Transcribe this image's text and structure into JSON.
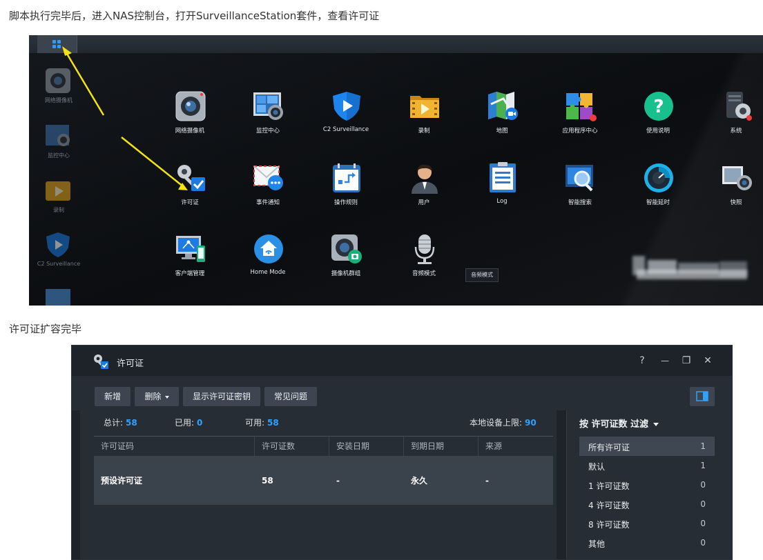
{
  "captions": {
    "step1": "脚本执行完毕后，进入NAS控制台，打开SurveillanceStation套件，查看许可证",
    "step2": "许可证扩容完毕"
  },
  "desktop": {
    "sidebar": [
      "网络摄像机",
      "监控中心",
      "录制",
      "C2 Surveillance"
    ],
    "apps": [
      {
        "label": "网络摄像机",
        "icon": "camera-icon"
      },
      {
        "label": "监控中心",
        "icon": "monitor-center-icon"
      },
      {
        "label": "C2 Surveillance",
        "icon": "c2-shield-icon"
      },
      {
        "label": "录制",
        "icon": "recording-folder-icon"
      },
      {
        "label": "地图",
        "icon": "map-icon"
      },
      {
        "label": "应用程序中心",
        "icon": "puzzle-icon"
      },
      {
        "label": "使用说明",
        "icon": "help-icon"
      },
      {
        "label": "系统",
        "icon": "system-gear-icon"
      },
      {
        "label": "许可证",
        "icon": "license-key-icon"
      },
      {
        "label": "事件通知",
        "icon": "notification-icon"
      },
      {
        "label": "操作规则",
        "icon": "action-rule-icon"
      },
      {
        "label": "用户",
        "icon": "user-icon"
      },
      {
        "label": "Log",
        "icon": "log-icon"
      },
      {
        "label": "智能搜索",
        "icon": "smart-search-icon"
      },
      {
        "label": "智能延时",
        "icon": "time-lapse-icon"
      },
      {
        "label": "快照",
        "icon": "snapshot-icon"
      },
      {
        "label": "客户端管理",
        "icon": "client-management-icon"
      },
      {
        "label": "Home Mode",
        "icon": "home-mode-icon"
      },
      {
        "label": "摄像机群组",
        "icon": "camera-group-icon"
      },
      {
        "label": "音频模式",
        "icon": "microphone-icon"
      }
    ],
    "tooltip": "音频模式"
  },
  "window": {
    "title": "许可证",
    "controls": {
      "help": "?",
      "minimize": "—",
      "maximize": "❐",
      "close": "✕"
    },
    "toolbar": {
      "add": "新增",
      "delete": "删除",
      "show_key": "显示许可证密钥",
      "faq": "常见问题"
    },
    "stats": {
      "total_label": "总计:",
      "total": "58",
      "used_label": "已用:",
      "used": "0",
      "available_label": "可用:",
      "available": "58",
      "limit_label": "本地设备上限:",
      "limit": "90"
    },
    "table": {
      "headers": [
        "许可证码",
        "许可证数",
        "安装日期",
        "到期日期",
        "来源"
      ],
      "rows": [
        [
          "预设许可证",
          "58",
          "-",
          "永久",
          "-"
        ]
      ]
    },
    "filter": {
      "title": "按 许可证数 过滤",
      "items": [
        {
          "label": "所有许可证",
          "count": "1"
        },
        {
          "label": "默认",
          "count": "1"
        },
        {
          "label": "1 许可证数",
          "count": "0"
        },
        {
          "label": "4 许可证数",
          "count": "0"
        },
        {
          "label": "8 许可证数",
          "count": "0"
        },
        {
          "label": "其他",
          "count": "0"
        }
      ]
    },
    "colors": {
      "accent": "#2fa2ff",
      "row": "#3a424c",
      "panel": "#262d35"
    }
  }
}
